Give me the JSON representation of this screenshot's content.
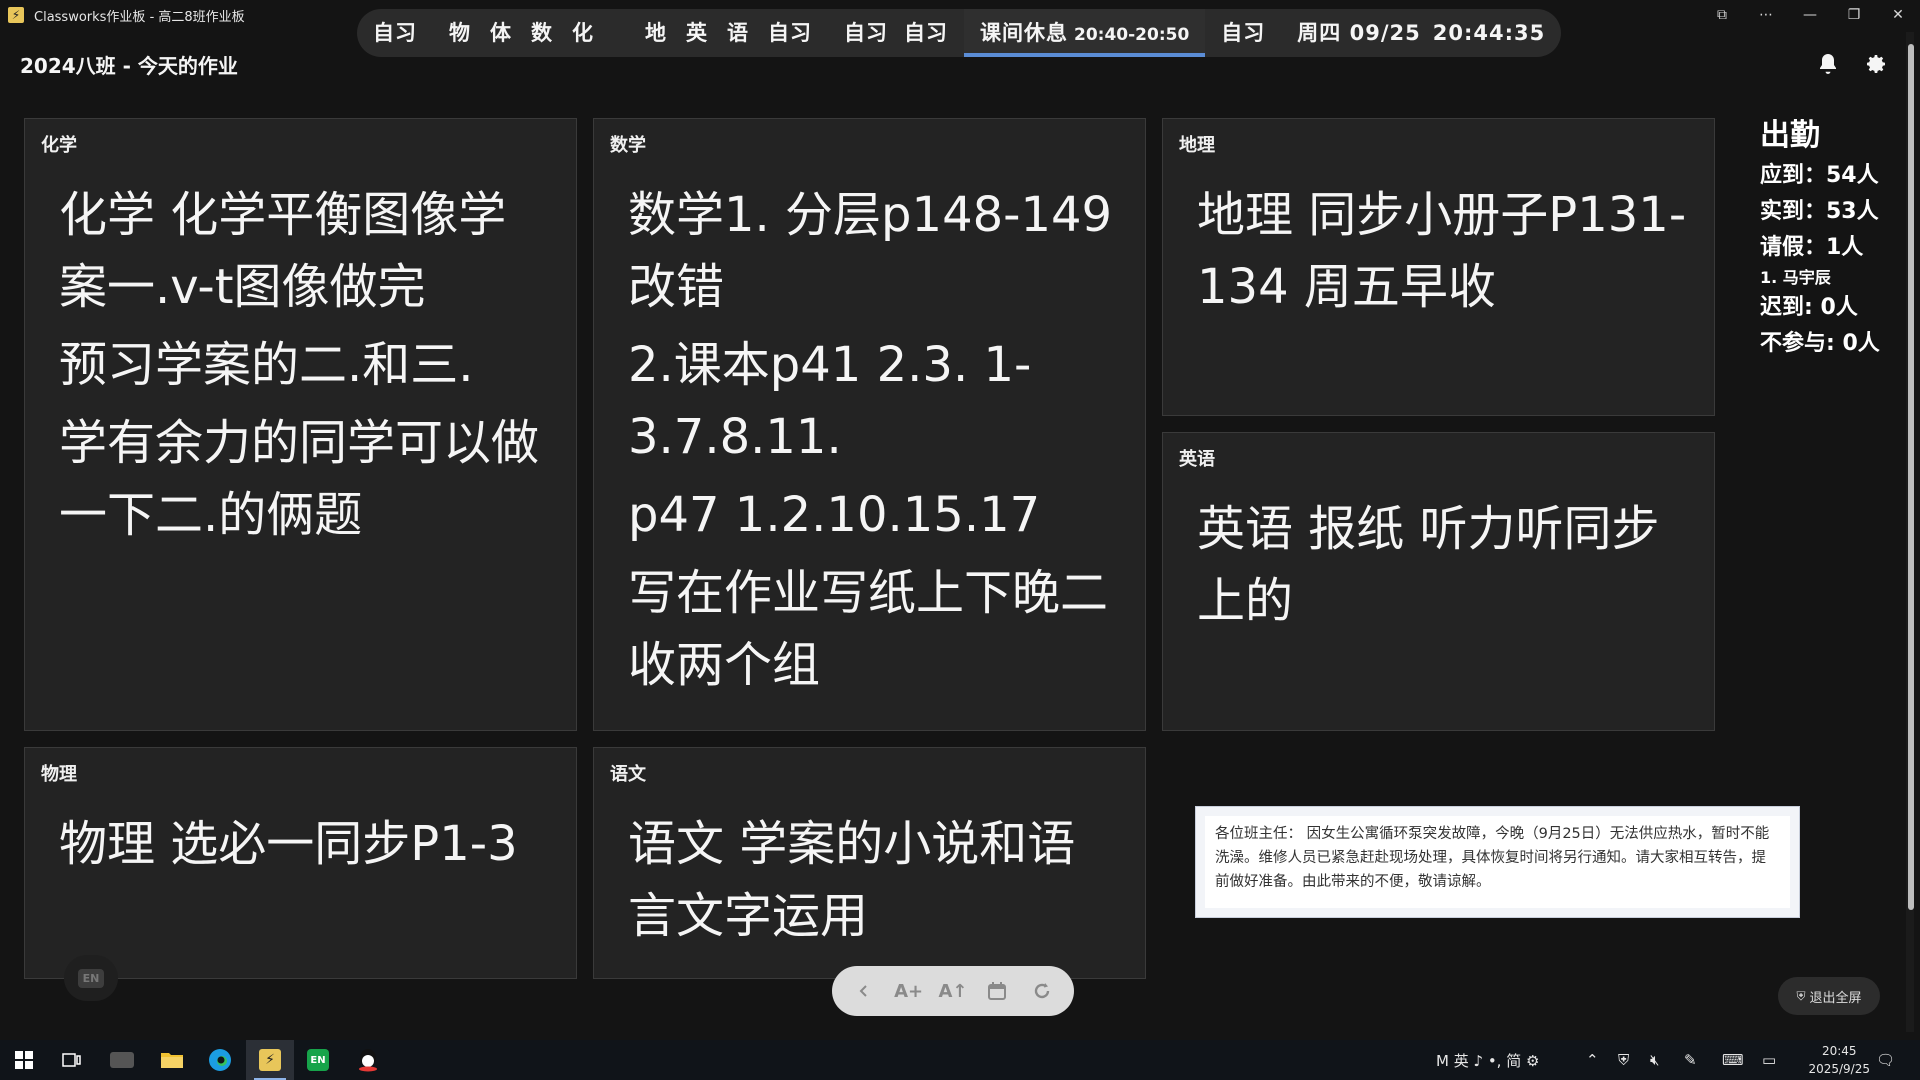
{
  "window": {
    "title": "Classworks作业板 - 高二8班作业板",
    "controls": [
      "⧉",
      "⋯",
      "—",
      "❐",
      "✕"
    ]
  },
  "schedule": {
    "items": [
      {
        "label": "自习",
        "wide": false
      },
      {
        "label": "物体数化",
        "wide": true
      },
      {
        "label": "地英语",
        "wide": true,
        "extra": "自习"
      },
      {
        "label": "自习",
        "wide": false,
        "extra": "自习"
      },
      {
        "label": "课间休息",
        "time_range": "20:40-20:50",
        "current": true
      },
      {
        "label": "自习",
        "wide": false
      }
    ],
    "date": "周四 09/25",
    "time": "20:44:35"
  },
  "header": {
    "class_title": "2024八班 - 今天的作业"
  },
  "cards": {
    "chemistry": {
      "label": "化学",
      "lines": [
        "化学 化学平衡图像学案一.v-t图像做完",
        "预习学案的二.和三.",
        "学有余力的同学可以做一下二.的俩题"
      ]
    },
    "math": {
      "label": "数学",
      "lines": [
        "数学1. 分层p148-149改错",
        "2.课本p41 2.3. 1-3.7.8.11.",
        "p47 1.2.10.15.17",
        "写在作业写纸上下晚二收两个组"
      ]
    },
    "geography": {
      "label": "地理",
      "lines": [
        "地理 同步小册子P131-134 周五早收"
      ]
    },
    "english": {
      "label": "英语",
      "lines": [
        "英语 报纸 听力听同步上的"
      ]
    },
    "physics": {
      "label": "物理",
      "lines": [
        "物理 选必一同步P1-3"
      ]
    },
    "chinese": {
      "label": "语文",
      "lines": [
        "语文 学案的小说和语言文字运用"
      ]
    }
  },
  "attendance": {
    "title": "出勤",
    "expected": "应到：54人",
    "actual": "实到：53人",
    "leave": "请假：1人",
    "leave_names": [
      "1. 马宇辰"
    ],
    "late": "迟到: 0人",
    "absent": "不参与: 0人"
  },
  "notice": {
    "text": "各位班主任： 因女生公寓循环泵突发故障，今晚（9月25日）无法供应热水，暂时不能洗澡。维修人员已紧急赶赴现场处理，具体恢复时间将另行通知。请大家相互转告，提前做好准备。由此带来的不便，敬请谅解。"
  },
  "toolbar": {
    "buttons": [
      "chevron-left-icon",
      "font-increase-icon",
      "font-decrease-icon",
      "calendar-icon",
      "refresh-icon"
    ]
  },
  "en_badge": "EN",
  "exit_fullscreen": "退出全屏",
  "taskbar": {
    "tray_ime": "M 英 ♪ •, 简 ⚙",
    "clock_time": "20:45",
    "clock_date": "2025/9/25"
  }
}
